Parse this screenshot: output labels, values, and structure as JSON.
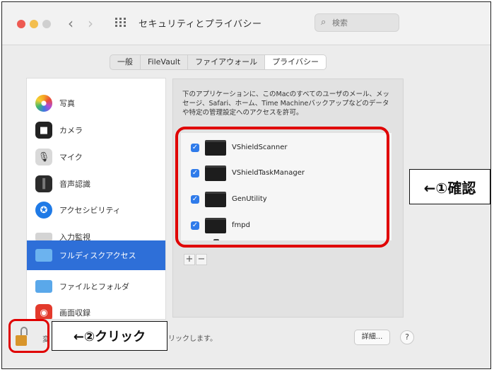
{
  "window": {
    "title": "セキュリティとプライバシー",
    "search_placeholder": "検索"
  },
  "tabs": [
    {
      "label": "一般",
      "active": false
    },
    {
      "label": "FileVault",
      "active": false
    },
    {
      "label": "ファイアウォール",
      "active": false
    },
    {
      "label": "プライバシー",
      "active": true
    }
  ],
  "sidebar": {
    "items": [
      {
        "label": "写真",
        "icon": "photos-icon"
      },
      {
        "label": "カメラ",
        "icon": "camera-icon"
      },
      {
        "label": "マイク",
        "icon": "microphone-icon"
      },
      {
        "label": "音声認識",
        "icon": "speech-recognition-icon"
      },
      {
        "label": "アクセシビリティ",
        "icon": "accessibility-icon"
      },
      {
        "label": "入力監視",
        "icon": "input-monitoring-icon"
      },
      {
        "label": "フルディスクアクセス",
        "icon": "folder-icon",
        "selected": true
      },
      {
        "label": "ファイルとフォルダ",
        "icon": "folder-icon"
      },
      {
        "label": "画面収録",
        "icon": "screen-recording-icon"
      }
    ]
  },
  "panel": {
    "description": "下のアプリケーションに、このMacのすべてのユーザのメール、メッセージ、Safari、ホーム、Time Machineバックアップなどのデータや特定の管理設定へのアクセスを許可。",
    "apps": [
      {
        "name": "VShieldScanner",
        "checked": true
      },
      {
        "name": "VShieldTaskManager",
        "checked": true
      },
      {
        "name": "GenUtility",
        "checked": true
      },
      {
        "name": "fmpd",
        "checked": true
      }
    ],
    "add_label": "+",
    "remove_label": "−"
  },
  "footer": {
    "hint_prefix": "変",
    "hint_suffix": "リックします。",
    "details_label": "詳細...",
    "help_label": "?"
  },
  "annotations": {
    "confirm": "←①確認",
    "click": "←②クリック"
  },
  "colors": {
    "selection": "#2e6fd8",
    "annotation_red": "#e00000",
    "checkbox": "#2f7bea"
  }
}
